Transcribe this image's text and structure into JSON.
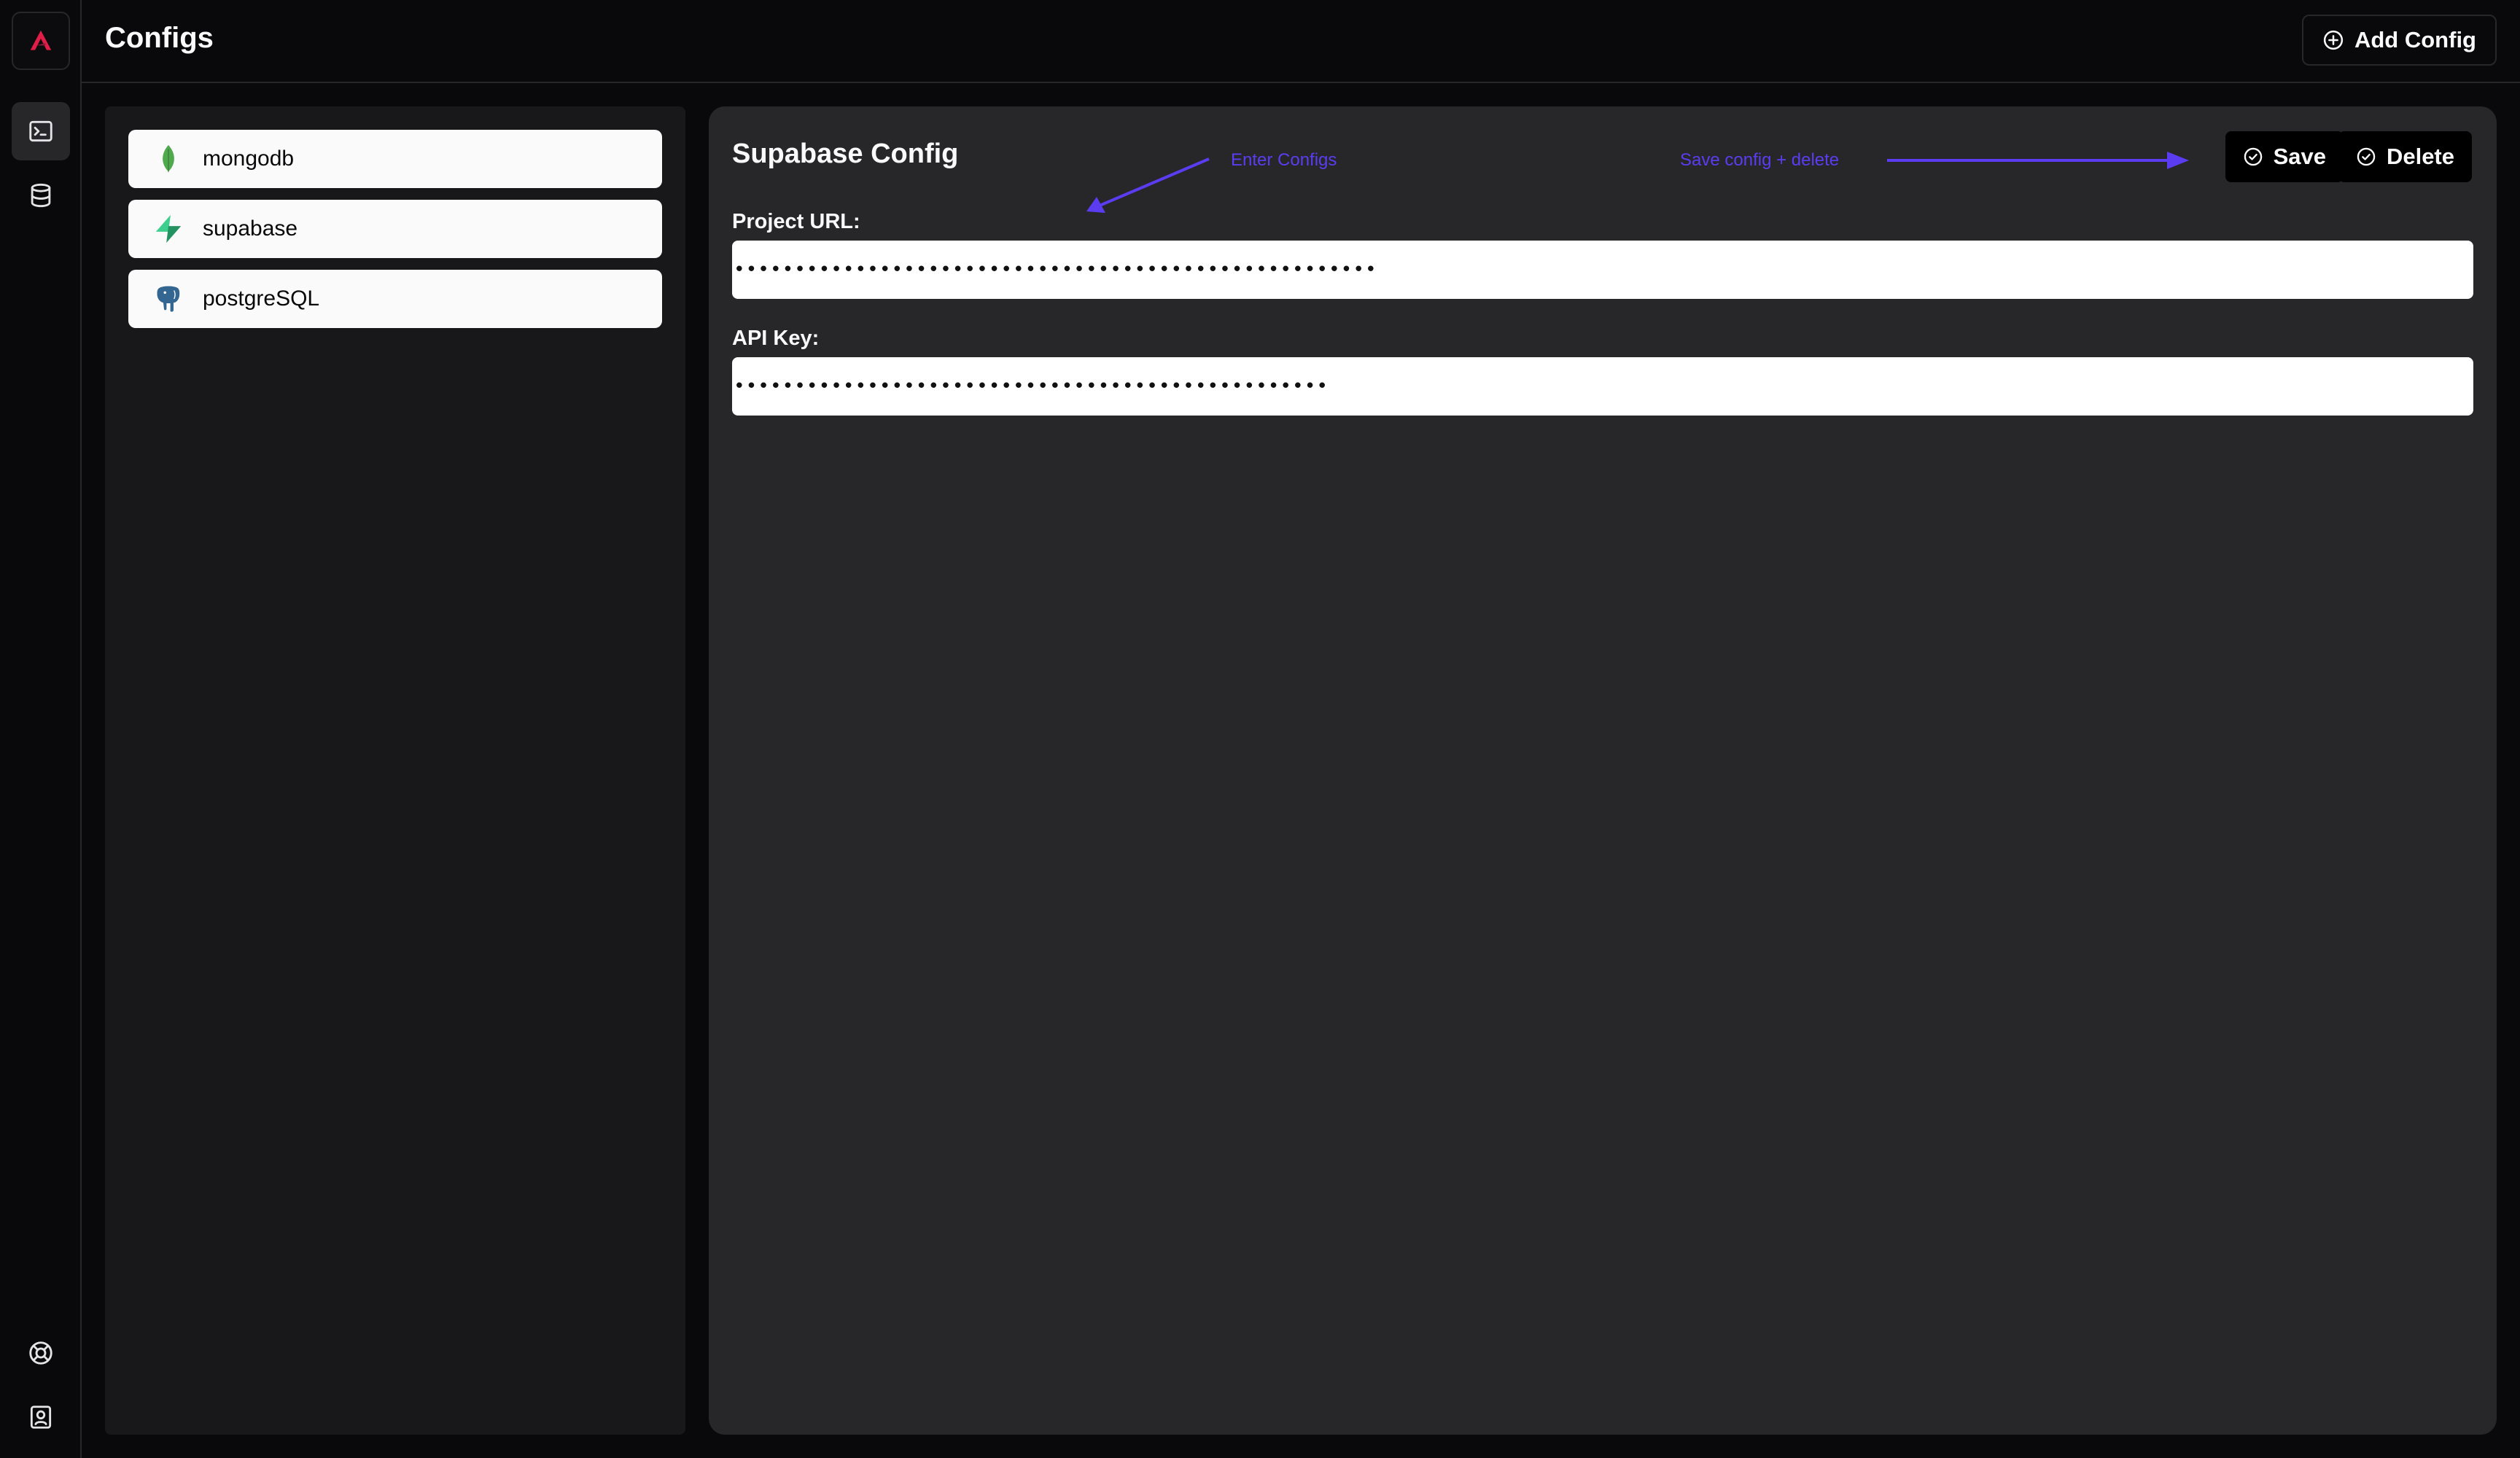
{
  "header": {
    "title": "Configs",
    "add_button_label": "Add Config"
  },
  "rail": {
    "items": [
      {
        "icon": "app-logo-icon"
      },
      {
        "icon": "terminal-icon",
        "active": true
      },
      {
        "icon": "database-icon"
      },
      {
        "icon": "lifebuoy-icon"
      },
      {
        "icon": "contact-icon"
      }
    ]
  },
  "configs": {
    "items": [
      {
        "label": "mongodb",
        "icon": "mongodb-leaf-icon"
      },
      {
        "label": "supabase",
        "icon": "supabase-bolt-icon"
      },
      {
        "label": "postgreSQL",
        "icon": "postgresql-elephant-icon"
      }
    ]
  },
  "detail": {
    "title": "Supabase Config",
    "save_label": "Save",
    "delete_label": "Delete",
    "fields": [
      {
        "label": "Project URL:",
        "value": "•••••••••••••••••••••••••••••••••••••••••••••••••••••"
      },
      {
        "label": "API Key:",
        "value": "•••••••••••••••••••••••••••••••••••••••••••••••••"
      }
    ]
  },
  "annotations": {
    "enter_configs": "Enter Configs",
    "save_delete": "Save config + delete",
    "color": "#5b3cf0"
  },
  "colors": {
    "background": "#09090b",
    "panel": "#18181b",
    "detail_panel": "#27272a",
    "item_bg": "#fafafa"
  }
}
